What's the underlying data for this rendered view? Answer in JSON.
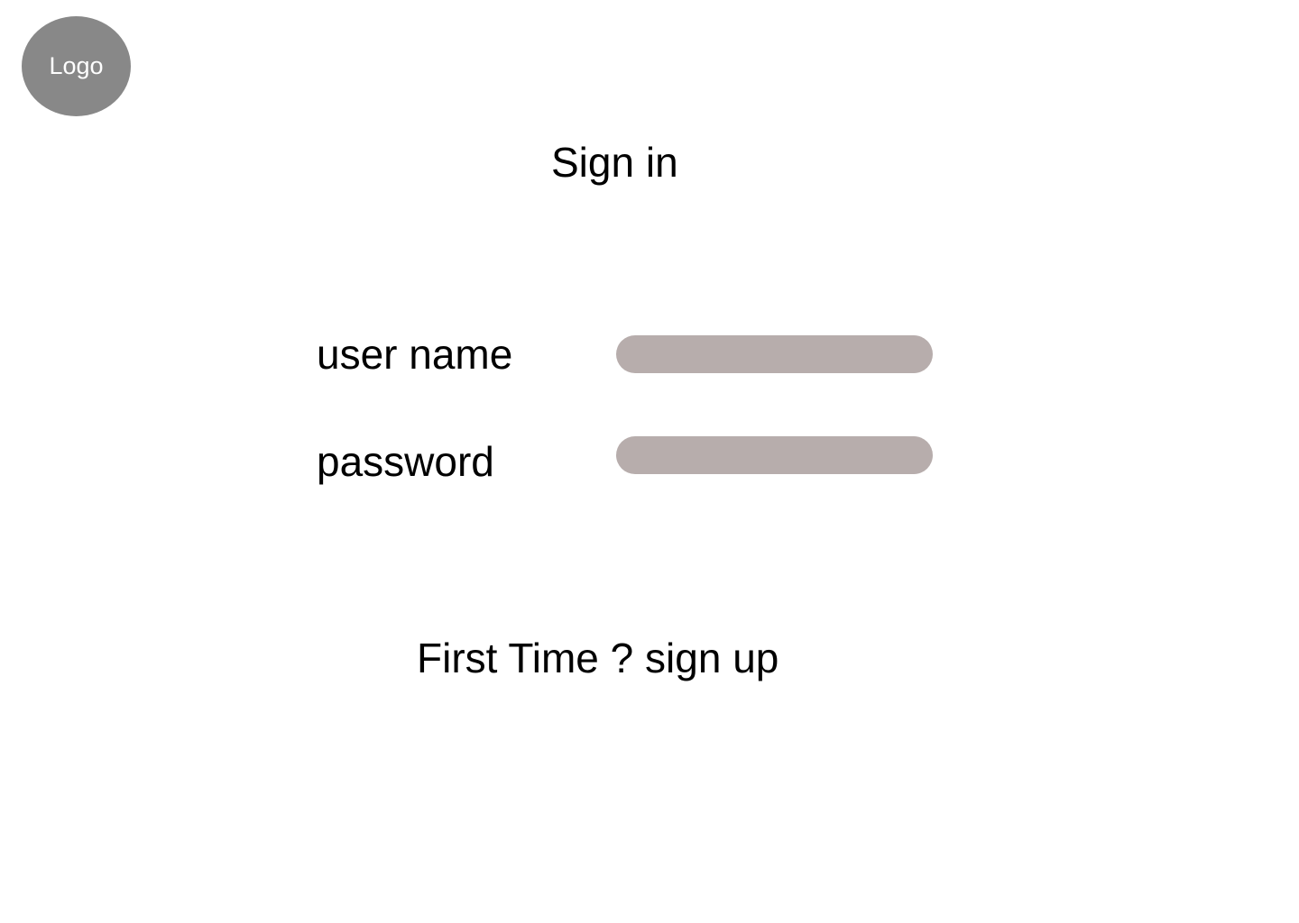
{
  "logo": {
    "label": "Logo"
  },
  "page": {
    "title": "Sign in"
  },
  "form": {
    "username": {
      "label": "user name",
      "value": "",
      "placeholder": ""
    },
    "password": {
      "label": "password",
      "value": "",
      "placeholder": ""
    }
  },
  "footer": {
    "signup_text": "First Time ? sign up"
  },
  "colors": {
    "logo_bg": "#888888",
    "input_bg": "#b7adac",
    "background": "#ffffff",
    "text": "#000000"
  }
}
